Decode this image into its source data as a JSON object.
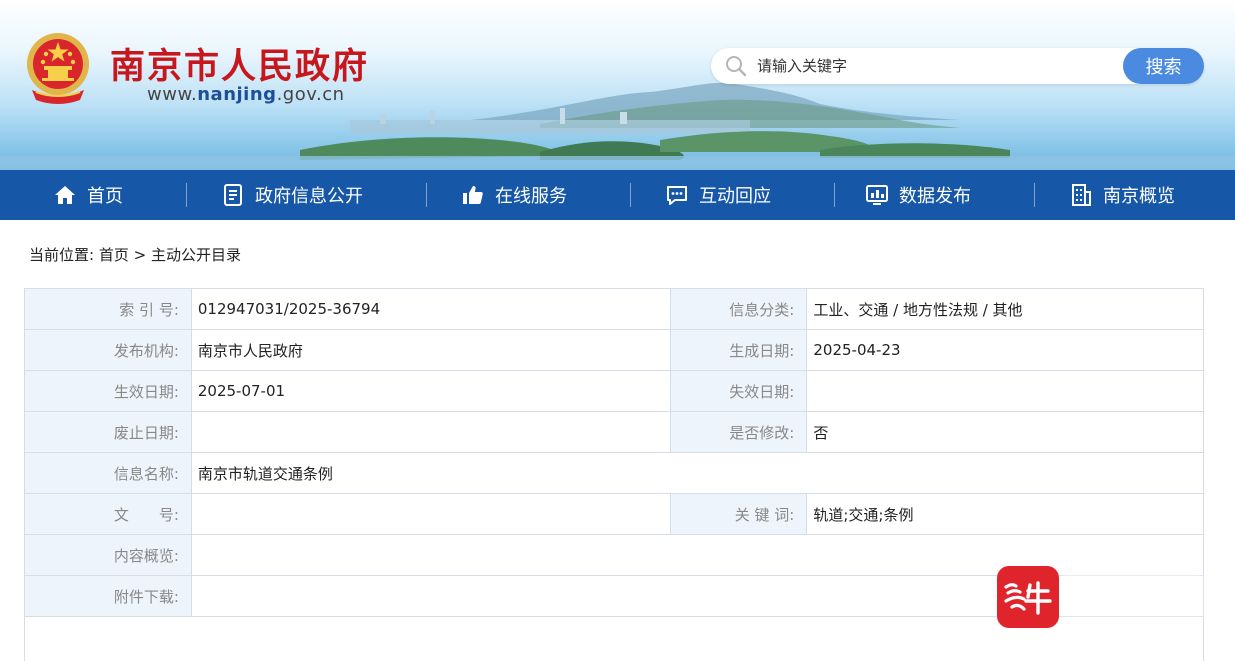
{
  "header": {
    "site_name": "南京市人民政府",
    "url_prefix": "www.",
    "url_domain": "nanjing",
    "url_suffix": ".gov.cn",
    "emblem_icon": "national-emblem-icon"
  },
  "search": {
    "placeholder": "请输入关键字",
    "button_label": "搜索"
  },
  "nav": {
    "items": [
      {
        "label": "首页",
        "icon": "home-icon"
      },
      {
        "label": "政府信息公开",
        "icon": "document-icon"
      },
      {
        "label": "在线服务",
        "icon": "thumbs-up-icon"
      },
      {
        "label": "互动回应",
        "icon": "chat-icon"
      },
      {
        "label": "数据发布",
        "icon": "bar-chart-icon"
      },
      {
        "label": "南京概览",
        "icon": "building-icon"
      }
    ]
  },
  "breadcrumb": {
    "prefix": "当前位置:",
    "home": "首页",
    "separator": " > ",
    "current": "主动公开目录"
  },
  "info": {
    "index_label": "索 引 号:",
    "index_value": "012947031/2025-36794",
    "category_label": "信息分类:",
    "category_value": "工业、交通 / 地方性法规 / 其他",
    "publisher_label": "发布机构:",
    "publisher_value": "南京市人民政府",
    "generated_label": "生成日期:",
    "generated_value": "2025-04-23",
    "effective_label": "生效日期:",
    "effective_value": "2025-07-01",
    "expiry_label": "失效日期:",
    "expiry_value": "",
    "abolish_label": "废止日期:",
    "abolish_value": "",
    "modified_label": "是否修改:",
    "modified_value": "否",
    "name_label": "信息名称:",
    "name_value": "南京市轨道交通条例",
    "doc_no_label": "文　　号:",
    "doc_no_value": "",
    "keywords_label": "关 键 词:",
    "keywords_value": "轨道;交通;条例",
    "summary_label": "内容概览:",
    "summary_value": "",
    "attachment_label": "附件下载:",
    "attachment_value": ""
  },
  "watermark": {
    "text": "紫牛",
    "color": "#e0242b"
  },
  "colors": {
    "nav_bg": "#1757a8",
    "title_red": "#c7171d",
    "search_button": "#4a8ae0",
    "label_bg": "#eef4fb"
  }
}
